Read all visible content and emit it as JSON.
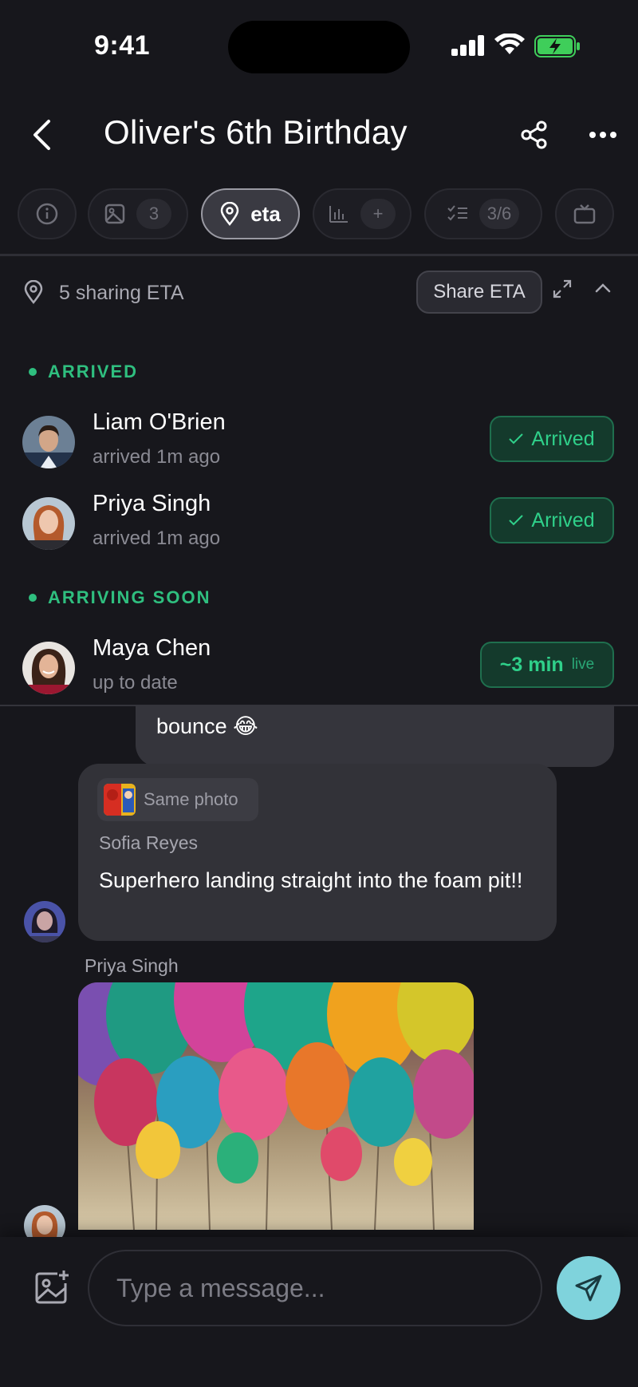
{
  "status_bar": {
    "time": "9:41"
  },
  "header": {
    "title": "Oliver's 6th Birthday"
  },
  "tabs": [
    {
      "id": "info",
      "icon": "info-icon",
      "badge": ""
    },
    {
      "id": "photos",
      "icon": "image-icon",
      "badge": "3"
    },
    {
      "id": "eta",
      "icon": "map-pin-icon",
      "label": "eta",
      "active": true
    },
    {
      "id": "polls",
      "icon": "bar-chart-icon",
      "badge": "+"
    },
    {
      "id": "tasks",
      "icon": "checklist-icon",
      "badge": "3/6"
    },
    {
      "id": "tv",
      "icon": "tv-icon",
      "badge": ""
    }
  ],
  "eta": {
    "sharing_text": "5 sharing ETA",
    "share_button": "Share ETA",
    "sections": {
      "arrived_label": "ARRIVED",
      "arriving_label": "ARRIVING SOON"
    },
    "arrived": [
      {
        "name": "Liam O'Brien",
        "status": "arrived 1m ago",
        "pill": "Arrived"
      },
      {
        "name": "Priya Singh",
        "status": "arrived 1m ago",
        "pill": "Arrived"
      }
    ],
    "arriving": [
      {
        "name": "Maya Chen",
        "status": "up to date",
        "eta": "~3 min",
        "live": "live"
      }
    ]
  },
  "chat": {
    "outgoing_fragment": "bounce 😂",
    "reply": {
      "chip_text": "Same photo",
      "sender": "Sofia Reyes",
      "text": "Superhero landing straight into the foam pit!!"
    },
    "photo_sender": "Priya Singh"
  },
  "composer": {
    "placeholder": "Type a message..."
  },
  "colors": {
    "background": "#17171c",
    "accent_green": "#2fbf7f",
    "send_button": "#7fd3dc"
  }
}
